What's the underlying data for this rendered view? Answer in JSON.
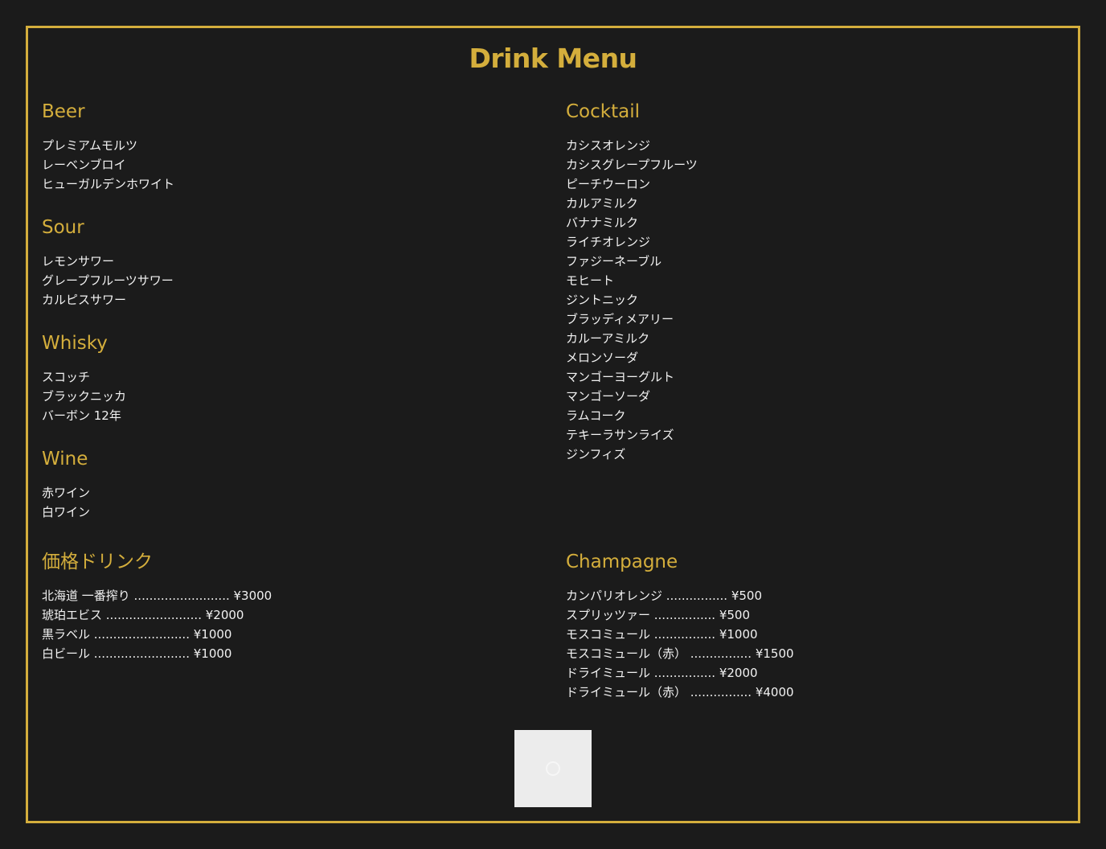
{
  "menu": {
    "title": "Drink Menu",
    "beer": {
      "heading": "Beer",
      "items": [
        "プレミアムモルツ",
        "レーベンブロイ",
        "ヒューガルデンホワイト"
      ]
    },
    "sour": {
      "heading": "Sour",
      "items": [
        "レモンサワー",
        "グレープフルーツサワー",
        "カルピスサワー"
      ]
    },
    "whisky": {
      "heading": "Whisky",
      "items": [
        "スコッチ",
        "ブラックニッカ",
        "バーボン 12年"
      ]
    },
    "wine": {
      "heading": "Wine",
      "items": [
        "赤ワイン",
        "白ワイン"
      ]
    },
    "cocktail": {
      "heading": "Cocktail",
      "items": [
        "カシスオレンジ",
        "カシスグレープフルーツ",
        "ピーチウーロン",
        "カルアミルク",
        "バナナミルク",
        "ライチオレンジ",
        "ファジーネーブル",
        "モヒート",
        "ジントニック",
        "ブラッディメアリー",
        "カルーアミルク",
        "メロンソーダ",
        "マンゴーヨーグルト",
        "マンゴーソーダ",
        "ラムコーク",
        "テキーラサンライズ",
        "ジンフィズ"
      ]
    },
    "priced_drinks": {
      "heading": "価格ドリンク",
      "items": [
        "北海道 一番搾り ......................... ¥3000",
        "琥珀エビス ......................... ¥2000",
        "黒ラベル ......................... ¥1000",
        "白ビール ......................... ¥1000"
      ]
    },
    "champagne": {
      "heading": "Champagne",
      "items": [
        "カンパリオレンジ ................ ¥500",
        "スプリッツァー ................ ¥500",
        "モスコミュール ................ ¥1000",
        "モスコミュール（赤） ................ ¥1500",
        "ドライミュール ................ ¥2000",
        "ドライミュール（赤） ................ ¥4000"
      ]
    }
  },
  "colors": {
    "background": "#1b1b1b",
    "accent": "#d4ae3c",
    "text": "#f2f2f2",
    "image_placeholder": "#ececec"
  },
  "icons": {
    "image_loading": "loading-spinner-icon"
  }
}
